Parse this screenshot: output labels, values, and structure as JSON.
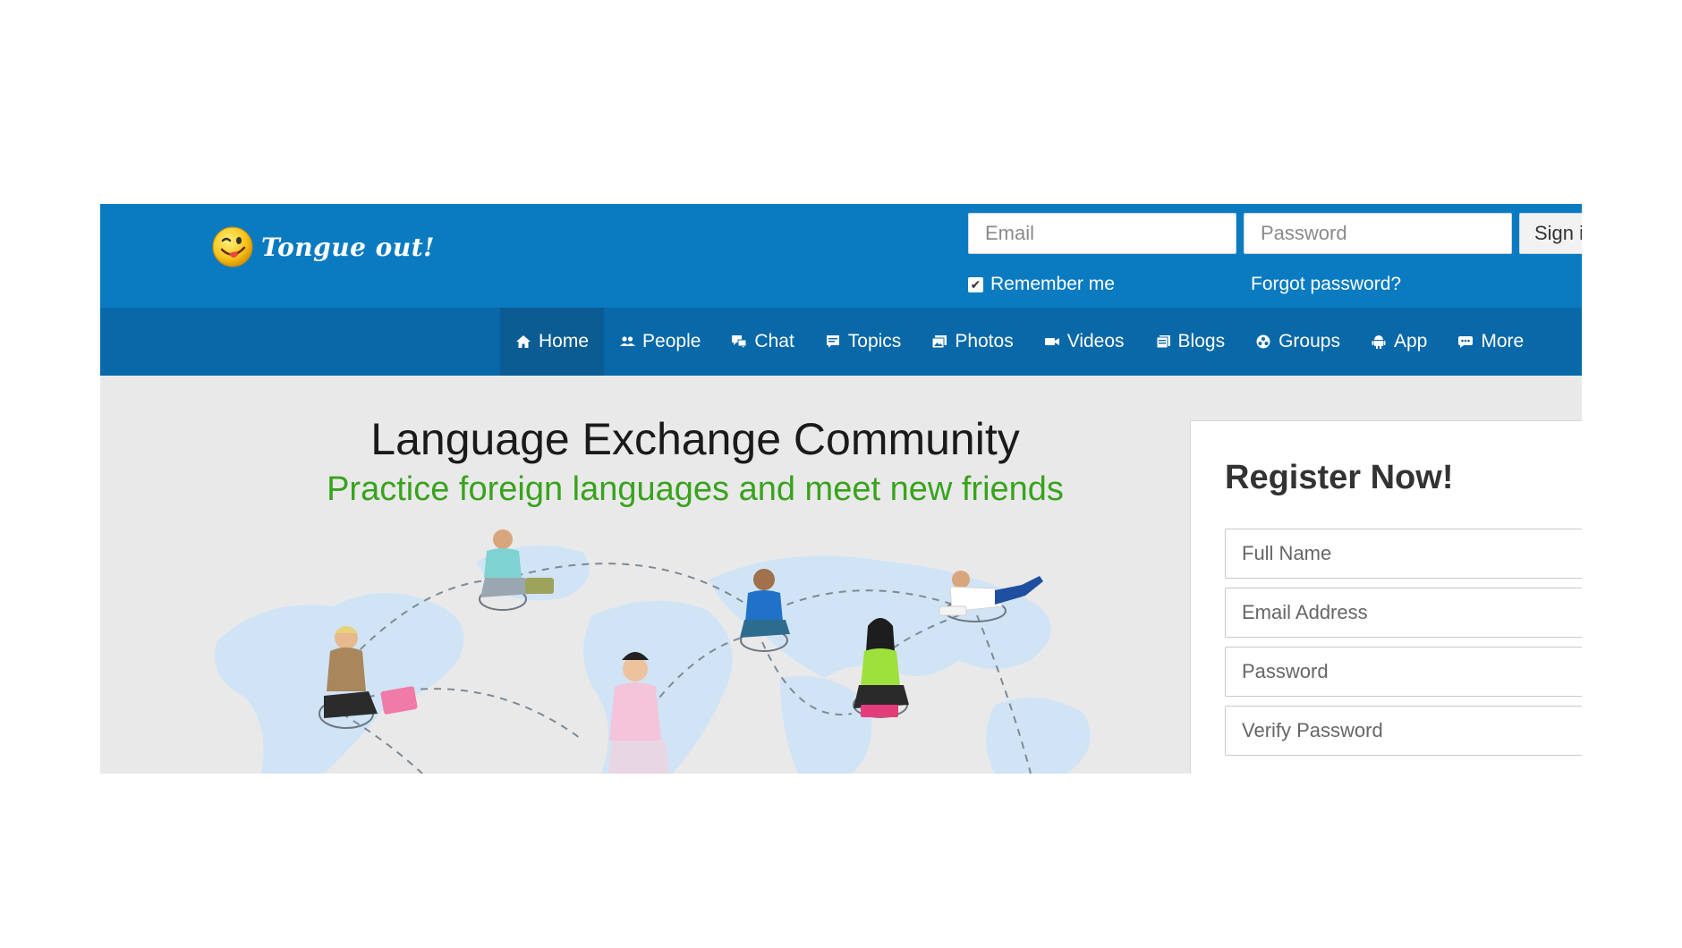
{
  "header": {
    "logo_text": "Tongue out!",
    "login": {
      "email_placeholder": "Email",
      "password_placeholder": "Password",
      "signin_label": "Sign i",
      "remember_label": "Remember me",
      "forgot_label": "Forgot password?"
    }
  },
  "nav": {
    "items": [
      {
        "label": "Home",
        "icon": "home-icon"
      },
      {
        "label": "People",
        "icon": "people-icon"
      },
      {
        "label": "Chat",
        "icon": "chat-icon"
      },
      {
        "label": "Topics",
        "icon": "topics-icon"
      },
      {
        "label": "Photos",
        "icon": "photos-icon"
      },
      {
        "label": "Videos",
        "icon": "videos-icon"
      },
      {
        "label": "Blogs",
        "icon": "blogs-icon"
      },
      {
        "label": "Groups",
        "icon": "groups-icon"
      },
      {
        "label": "App",
        "icon": "android-icon"
      },
      {
        "label": "More",
        "icon": "more-icon"
      }
    ],
    "active": "Home"
  },
  "hero": {
    "title": "Language Exchange Community",
    "subtitle": "Practice foreign languages and meet new friends"
  },
  "register": {
    "title": "Register Now!",
    "fullname_placeholder": "Full Name",
    "email_placeholder": "Email Address",
    "password_placeholder": "Password",
    "verify_placeholder": "Verify Password"
  },
  "colors": {
    "header_blue": "#0a7bc1",
    "nav_blue": "#0868a8",
    "nav_active": "#0a5c93",
    "subtitle_green": "#38a31c",
    "page_gray": "#e9e9ea"
  }
}
